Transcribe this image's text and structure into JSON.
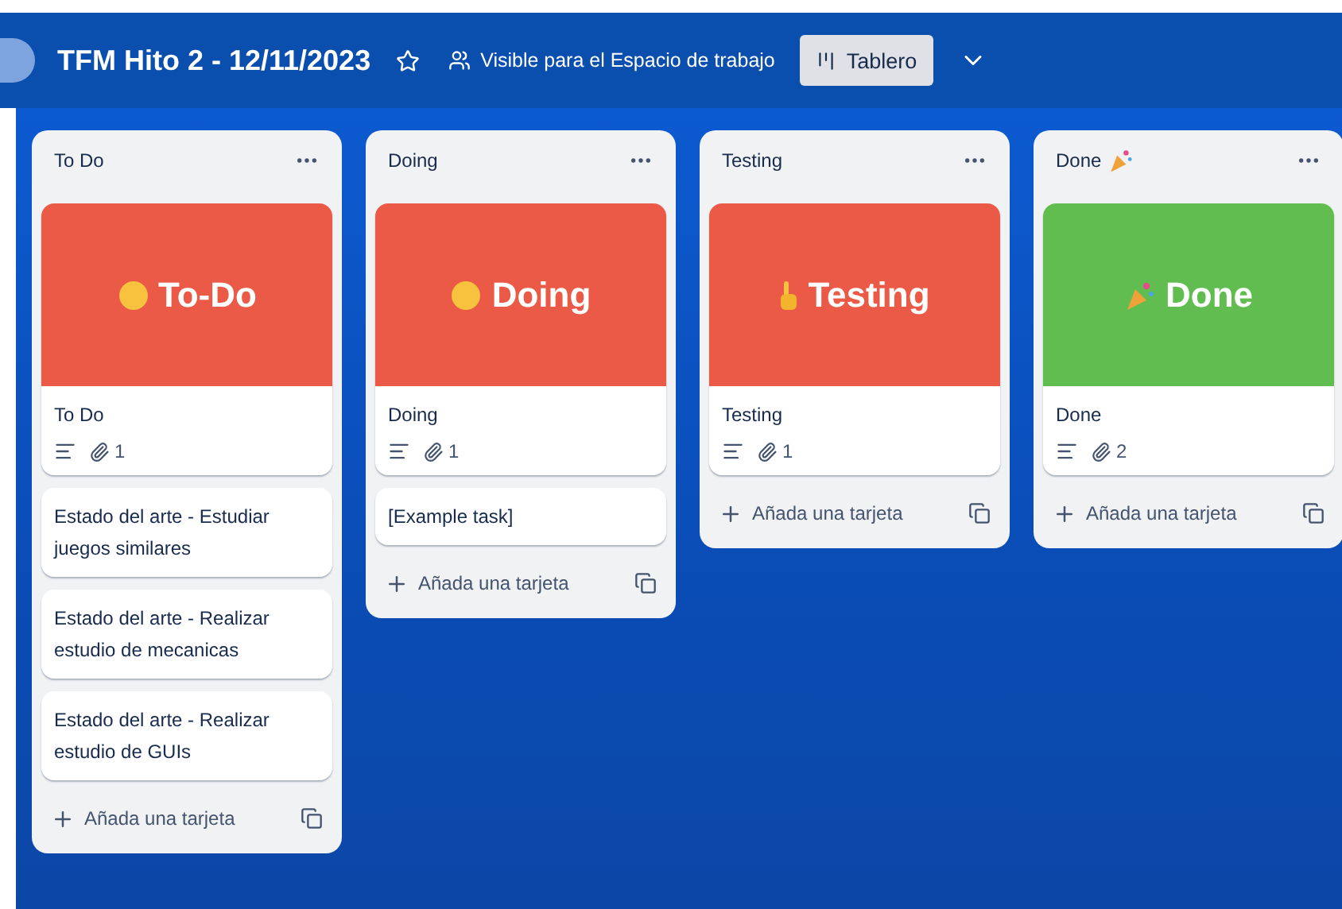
{
  "board": {
    "title": "TFM Hito 2 - 12/11/2023",
    "starred": false,
    "visibility": "Visible para el Espacio de trabajo",
    "view": "Tablero"
  },
  "lists": [
    {
      "title": "To Do",
      "cover": {
        "color": "#eb5a46",
        "emoji": {
          "kind": "face"
        },
        "title": "To-Do"
      },
      "cover_card": {
        "title": "To Do",
        "attachments": "1"
      },
      "cards": [
        "Estado del arte - Estudiar juegos similares",
        "Estado del arte - Realizar estudio de mecanicas",
        "Estado del arte - Realizar estudio de GUIs"
      ],
      "add_label": "Añada una tarjeta"
    },
    {
      "title": "Doing",
      "cover": {
        "color": "#eb5a46",
        "emoji": {
          "kind": "face"
        },
        "title": "Doing"
      },
      "cover_card": {
        "title": "Doing",
        "attachments": "1"
      },
      "cards": [
        "[Example task]"
      ],
      "add_label": "Añada una tarjeta"
    },
    {
      "title": "Testing",
      "cover": {
        "color": "#eb5a46",
        "emoji": {
          "kind": "hand"
        },
        "title": "Testing"
      },
      "cover_card": {
        "title": "Testing",
        "attachments": "1"
      },
      "add_label": "Añada una tarjeta"
    },
    {
      "title": "Done",
      "title_emoji": {
        "kind": "popper"
      },
      "cover": {
        "color": "#61bd4f",
        "emoji": {
          "kind": "popper"
        },
        "title": "Done"
      },
      "cover_card": {
        "title": "Done",
        "attachments": "2"
      },
      "add_label": "Añada una tarjeta"
    }
  ]
}
